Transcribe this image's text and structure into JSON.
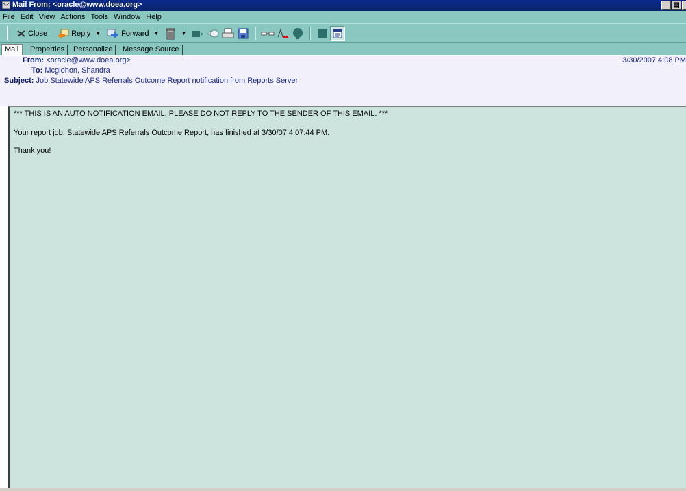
{
  "window": {
    "title": "Mail From: <oracle@www.doea.org>"
  },
  "menu": [
    "File",
    "Edit",
    "View",
    "Actions",
    "Tools",
    "Window",
    "Help"
  ],
  "toolbar": {
    "close_label": "Close",
    "reply_label": "Reply",
    "forward_label": "Forward",
    "icons": [
      "delete-icon",
      "next-icon",
      "previous-icon",
      "print-icon",
      "save-icon",
      "glasses-icon",
      "spellcheck-icon",
      "profile-icon",
      "green-square-icon",
      "preview-pane-icon"
    ]
  },
  "tabs": [
    "Mail",
    "Properties",
    "Personalize",
    "Message Source"
  ],
  "header": {
    "from_label": "From:",
    "from_value": "<oracle@www.doea.org>",
    "to_label": "To:",
    "to_value": "Mcglohon, Shandra",
    "subject_label": "Subject:",
    "subject_value": "Job Statewide APS Referrals Outcome Report notification from Reports Server",
    "date": "3/30/2007 4:08 PM"
  },
  "body": {
    "line1": "*** THIS IS AN AUTO NOTIFICATION EMAIL. PLEASE DO NOT REPLY TO THE SENDER OF THIS EMAIL. ***",
    "line2": "Your report job, Statewide APS Referrals Outcome Report, has finished at 3/30/07 4:07:44 PM.",
    "line3": "Thank you!"
  },
  "colors": {
    "titlebar": "#0a246a",
    "chrome": "#89c7c0",
    "header_bg": "#f1f0fb",
    "body_bg": "#cde3dd"
  }
}
